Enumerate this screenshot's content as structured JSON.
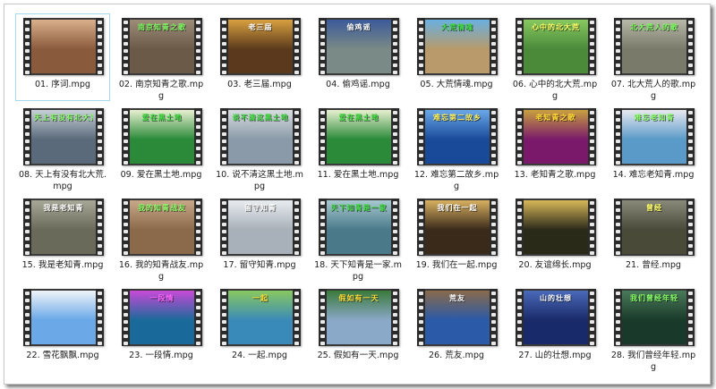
{
  "window": {
    "view": "large-icons"
  },
  "files": [
    {
      "name": "01. 序词.mpg",
      "caption": "",
      "bg": "#8a5a3c",
      "accent": "#d9b08c",
      "captionColor": "#ffe7a0",
      "selected": true
    },
    {
      "name": "02. 南京知青之歌.mpg",
      "caption": "南京知青之歌",
      "bg": "#6b5a48",
      "accent": "#9c8c78",
      "captionColor": "#7cfc60"
    },
    {
      "name": "03. 老三届.mpg",
      "caption": "老三届",
      "bg": "#5b3a1c",
      "accent": "#d8a040",
      "captionColor": "#ffffff"
    },
    {
      "name": "04. 偷鸡谣.mpg",
      "caption": "偷鸡谣",
      "bg": "#7a8a86",
      "accent": "#3b5a9a",
      "captionColor": "#ffffff"
    },
    {
      "name": "05. 大荒情魂.mpg",
      "caption": "大荒情魂",
      "bg": "#b89a6a",
      "accent": "#6ab0e0",
      "captionColor": "#3fdc3f"
    },
    {
      "name": "06. 心中的北大荒.mpg",
      "caption": "心中的北大荒",
      "bg": "#4a8a3a",
      "accent": "#88c860",
      "captionColor": "#ffff66"
    },
    {
      "name": "07. 北大荒人的歌.mpg",
      "caption": "北大荒人的歌",
      "bg": "#7a7a6a",
      "accent": "#b8b8a8",
      "captionColor": "#7cfc60"
    },
    {
      "name": "08. 天上有没有北大荒.mpg",
      "caption": "天上有没有北大荒",
      "bg": "#5a6a7a",
      "accent": "#c8d0d8",
      "captionColor": "#88ff66"
    },
    {
      "name": "09. 爱在黑土地.mpg",
      "caption": "爱在黑土地",
      "bg": "#2a8a3a",
      "accent": "#e8f0d0",
      "captionColor": "#3fdc3f"
    },
    {
      "name": "10. 说不清这黑土地.mpg",
      "caption": "说不清这黑土地",
      "bg": "#8a9aa8",
      "accent": "#d8dce0",
      "captionColor": "#3fdc3f"
    },
    {
      "name": "11. 爱在黑土地.mpg",
      "caption": "爱在黑土地",
      "bg": "#2a8a3a",
      "accent": "#e8f0d0",
      "captionColor": "#3fdc3f"
    },
    {
      "name": "12. 难忘第二故乡.mpg",
      "caption": "难忘第二故乡",
      "bg": "#1a4a9a",
      "accent": "#6aa8e8",
      "captionColor": "#ffee55"
    },
    {
      "name": "13. 老知青之歌.mpg",
      "caption": "老知青之歌",
      "bg": "#7a1a6a",
      "accent": "#c8a040",
      "captionColor": "#ffdd33"
    },
    {
      "name": "14. 难忘老知青.mpg",
      "caption": "难忘老知青",
      "bg": "#5a9ac8",
      "accent": "#e8e8f0",
      "captionColor": "#88ff66"
    },
    {
      "name": "15. 我是老知青.mpg",
      "caption": "我是老知青",
      "bg": "#6a6a5a",
      "accent": "#a8a898",
      "captionColor": "#ffffff"
    },
    {
      "name": "16. 我的知青战友.mpg",
      "caption": "我的知青战友",
      "bg": "#8a6a4a",
      "accent": "#c8a888",
      "captionColor": "#88ff66"
    },
    {
      "name": "17. 留守知青.mpg",
      "caption": "留守知青",
      "bg": "#a8b0b8",
      "accent": "#e8ecf0",
      "captionColor": "#ffffff"
    },
    {
      "name": "18. 天下知青是一家.mpg",
      "caption": "天下知青是一家",
      "bg": "#4a7a8a",
      "accent": "#a8c8d0",
      "captionColor": "#3fdc3f"
    },
    {
      "name": "19. 我们在一起.mpg",
      "caption": "我们在一起",
      "bg": "#3a2a1a",
      "accent": "#d8b060",
      "captionColor": "#ffffff"
    },
    {
      "name": "20. 友谊绵长.mpg",
      "caption": "",
      "bg": "#2a2a1a",
      "accent": "#d8b858",
      "captionColor": "#ffffff"
    },
    {
      "name": "21. 曾经.mpg",
      "caption": "曾经",
      "bg": "#4a4a3a",
      "accent": "#8a8a7a",
      "captionColor": "#ffff66"
    },
    {
      "name": "22. 雪花飘飘.mpg",
      "caption": "",
      "bg": "#6aa8e8",
      "accent": "#f0f4f8",
      "captionColor": "#ffffff"
    },
    {
      "name": "23. 一段情.mpg",
      "caption": "一段情",
      "bg": "#1a6a9a",
      "accent": "#c84ad8",
      "captionColor": "#ff66ff"
    },
    {
      "name": "24. 一起.mpg",
      "caption": "一起",
      "bg": "#3a8ab8",
      "accent": "#88c860",
      "captionColor": "#ffdd33"
    },
    {
      "name": "25. 假如有一天.mpg",
      "caption": "假如有一天",
      "bg": "#8aa8c8",
      "accent": "#3a7a3a",
      "captionColor": "#ffdd33"
    },
    {
      "name": "26. 荒友.mpg",
      "caption": "荒友",
      "bg": "#2a5aa8",
      "accent": "#8a6a4a",
      "captionColor": "#ffffff"
    },
    {
      "name": "27. 山的壮想.mpg",
      "caption": "山的壮想",
      "bg": "#1a2a6a",
      "accent": "#4a6ab8",
      "captionColor": "#ffffff"
    },
    {
      "name": "28. 我们曾经年轻.mpg",
      "caption": "我们曾经年轻",
      "bg": "#1a3a2a",
      "accent": "#4a7a5a",
      "captionColor": "#88ff66"
    }
  ]
}
